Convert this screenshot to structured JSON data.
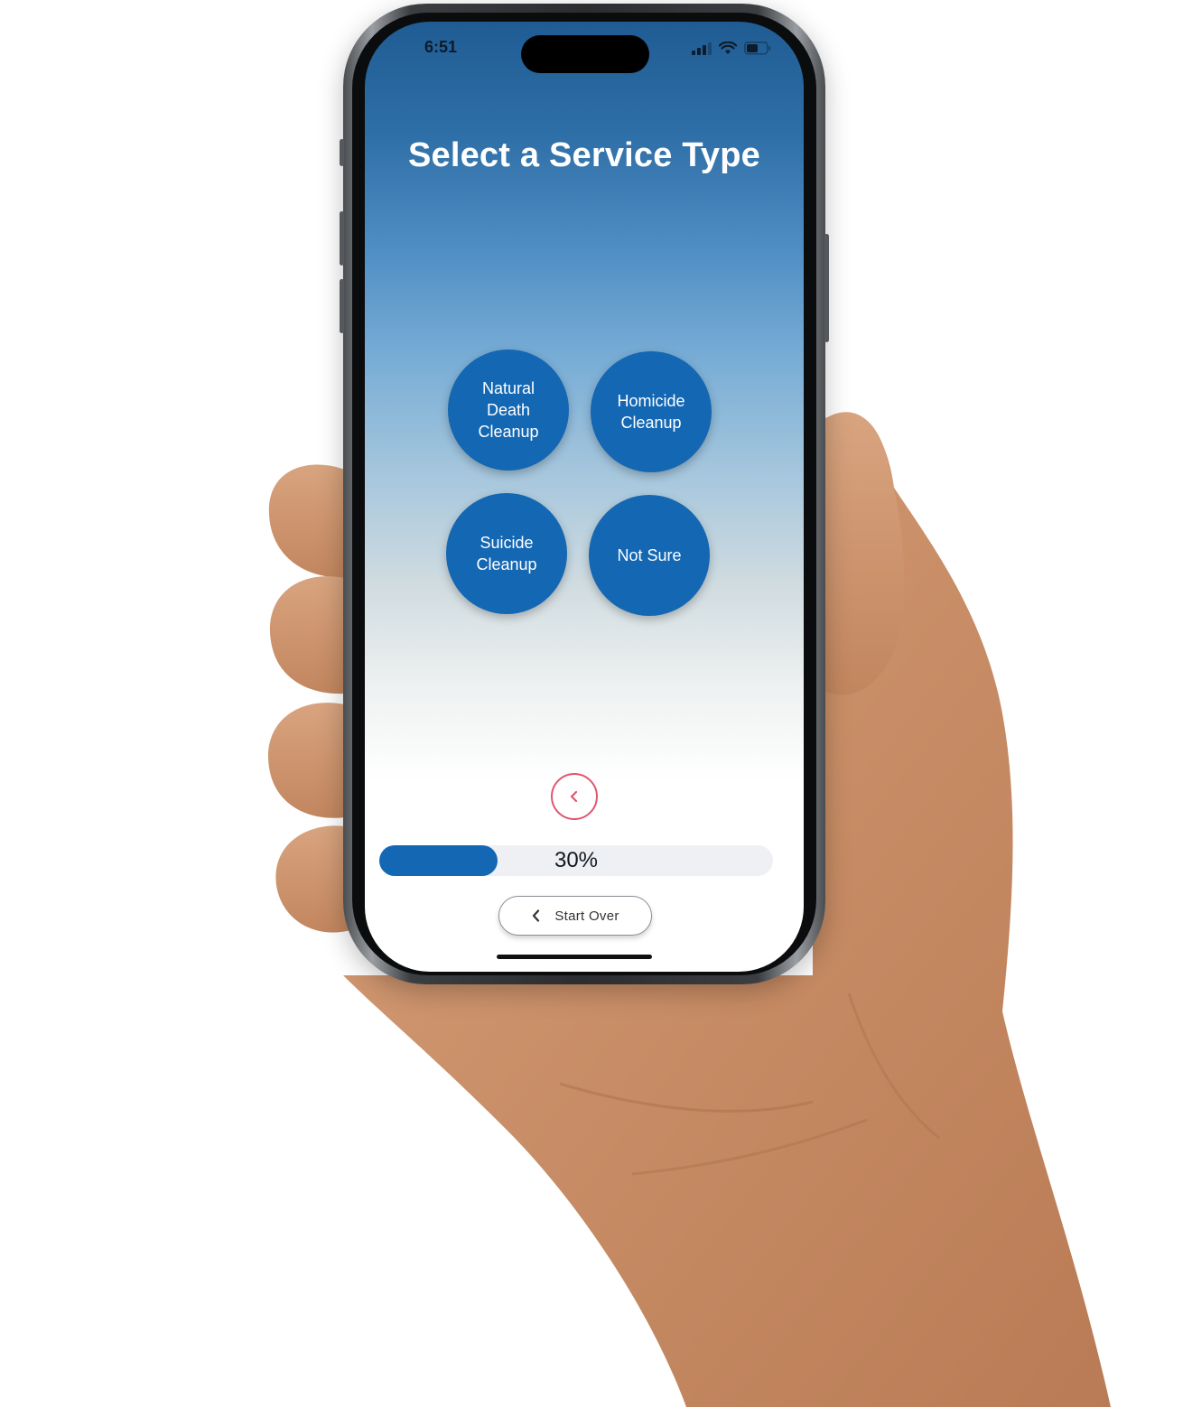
{
  "status_bar": {
    "time": "6:51"
  },
  "screen": {
    "title": "Select a Service Type"
  },
  "services": [
    {
      "label": "Natural\nDeath\nCleanup"
    },
    {
      "label": "Homicide\nCleanup"
    },
    {
      "label": "Suicide\nCleanup"
    },
    {
      "label": "Not Sure"
    }
  ],
  "progress": {
    "percent": 30,
    "label": "30%"
  },
  "footer": {
    "start_over_label": "Start Over"
  },
  "colors": {
    "accent_blue": "#1467b3",
    "back_ring": "#e0566f",
    "header_gradient_top": "#1f5c93"
  },
  "icons": {
    "back": "chevron-left-icon",
    "start_over": "chevron-left-icon",
    "wifi": "wifi-icon",
    "battery": "battery-icon",
    "signal": "cellular-signal-icon"
  }
}
